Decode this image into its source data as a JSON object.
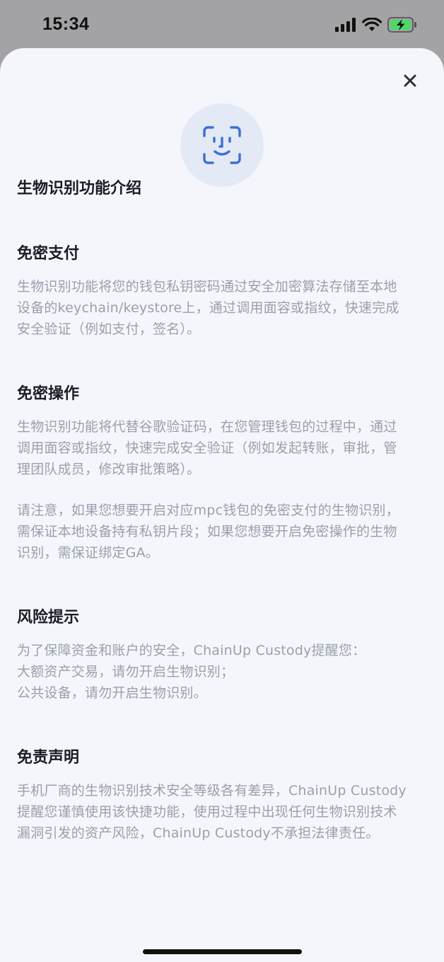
{
  "status_bar": {
    "time": "15:34",
    "signal_icon": "cellular-signal-icon",
    "wifi_icon": "wifi-icon",
    "battery_icon": "battery-charging-icon",
    "battery_color": "#4cd964"
  },
  "sheet": {
    "close_icon": "close-icon",
    "face_icon": "face-id-icon",
    "accent_color": "#3b6fd8",
    "intro_title": "生物识别功能介绍",
    "sections": [
      {
        "title": "免密支付",
        "paragraphs": [
          "生物识别功能将您的钱包私钥密码通过安全加密算法存储至本地\n设备的keychain/keystore上，通过调用面容或指纹，快速完成\n安全验证（例如支付，签名）。"
        ]
      },
      {
        "title": "免密操作",
        "paragraphs": [
          "生物识别功能将代替谷歌验证码，在您管理钱包的过程中，通过\n调用面容或指纹，快速完成安全验证（例如发起转账，审批，管\n理团队成员，修改审批策略）。",
          "请注意，如果您想要开启对应mpc钱包的免密支付的生物识别，\n需保证本地设备持有私钥片段；如果您想要开启免密操作的生物\n识别，需保证绑定GA。"
        ]
      },
      {
        "title": "风险提示",
        "paragraphs": [
          "为了保障资金和账户的安全，ChainUp Custody提醒您：\n大额资产交易，请勿开启生物识别；\n公共设备，请勿开启生物识别。"
        ]
      },
      {
        "title": "免责声明",
        "paragraphs": [
          "手机厂商的生物识别技术安全等级各有差异，ChainUp Custody\n提醒您谨慎使用该快捷功能，使用过程中出现任何生物识别技术\n漏洞引发的资产风险，ChainUp Custody不承担法律责任。"
        ]
      }
    ]
  }
}
